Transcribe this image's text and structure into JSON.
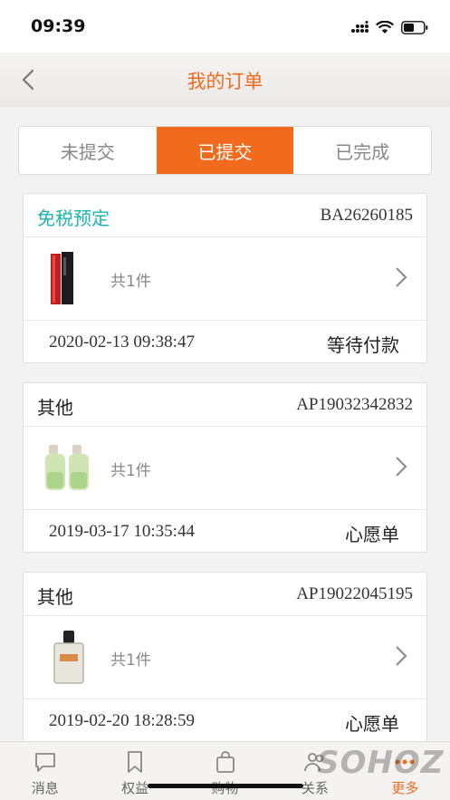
{
  "status_bar": {
    "time": "09:39"
  },
  "nav": {
    "title": "我的订单"
  },
  "tabs": [
    {
      "label": "未提交",
      "active": false
    },
    {
      "label": "已提交",
      "active": true
    },
    {
      "label": "已完成",
      "active": false
    }
  ],
  "orders": [
    {
      "type": "免税预定",
      "order_no": "BA26260185",
      "count": "共1件",
      "datetime": "2020-02-13 09:38:47",
      "status": "等待付款",
      "thumb_icon": "lipstick-product-image"
    },
    {
      "type": "其他",
      "order_no": "AP19032342832",
      "count": "共1件",
      "datetime": "2019-03-17 10:35:44",
      "status": "心愿单",
      "thumb_icon": "perfume-pair-product-image"
    },
    {
      "type": "其他",
      "order_no": "AP19022045195",
      "count": "共1件",
      "datetime": "2019-02-20 18:28:59",
      "status": "心愿单",
      "thumb_icon": "perfume-bottle-product-image"
    }
  ],
  "tab_bar": [
    {
      "label": "消息",
      "icon": "message-icon"
    },
    {
      "label": "权益",
      "icon": "bookmark-icon"
    },
    {
      "label": "购物",
      "icon": "shopping-bag-icon"
    },
    {
      "label": "关系",
      "icon": "people-icon"
    },
    {
      "label": "更多",
      "icon": "more-icon"
    }
  ],
  "watermark": "SOHOZ",
  "colors": {
    "accent": "#f26a1b",
    "teal": "#1cb5b0",
    "background": "#f2f2f2"
  }
}
